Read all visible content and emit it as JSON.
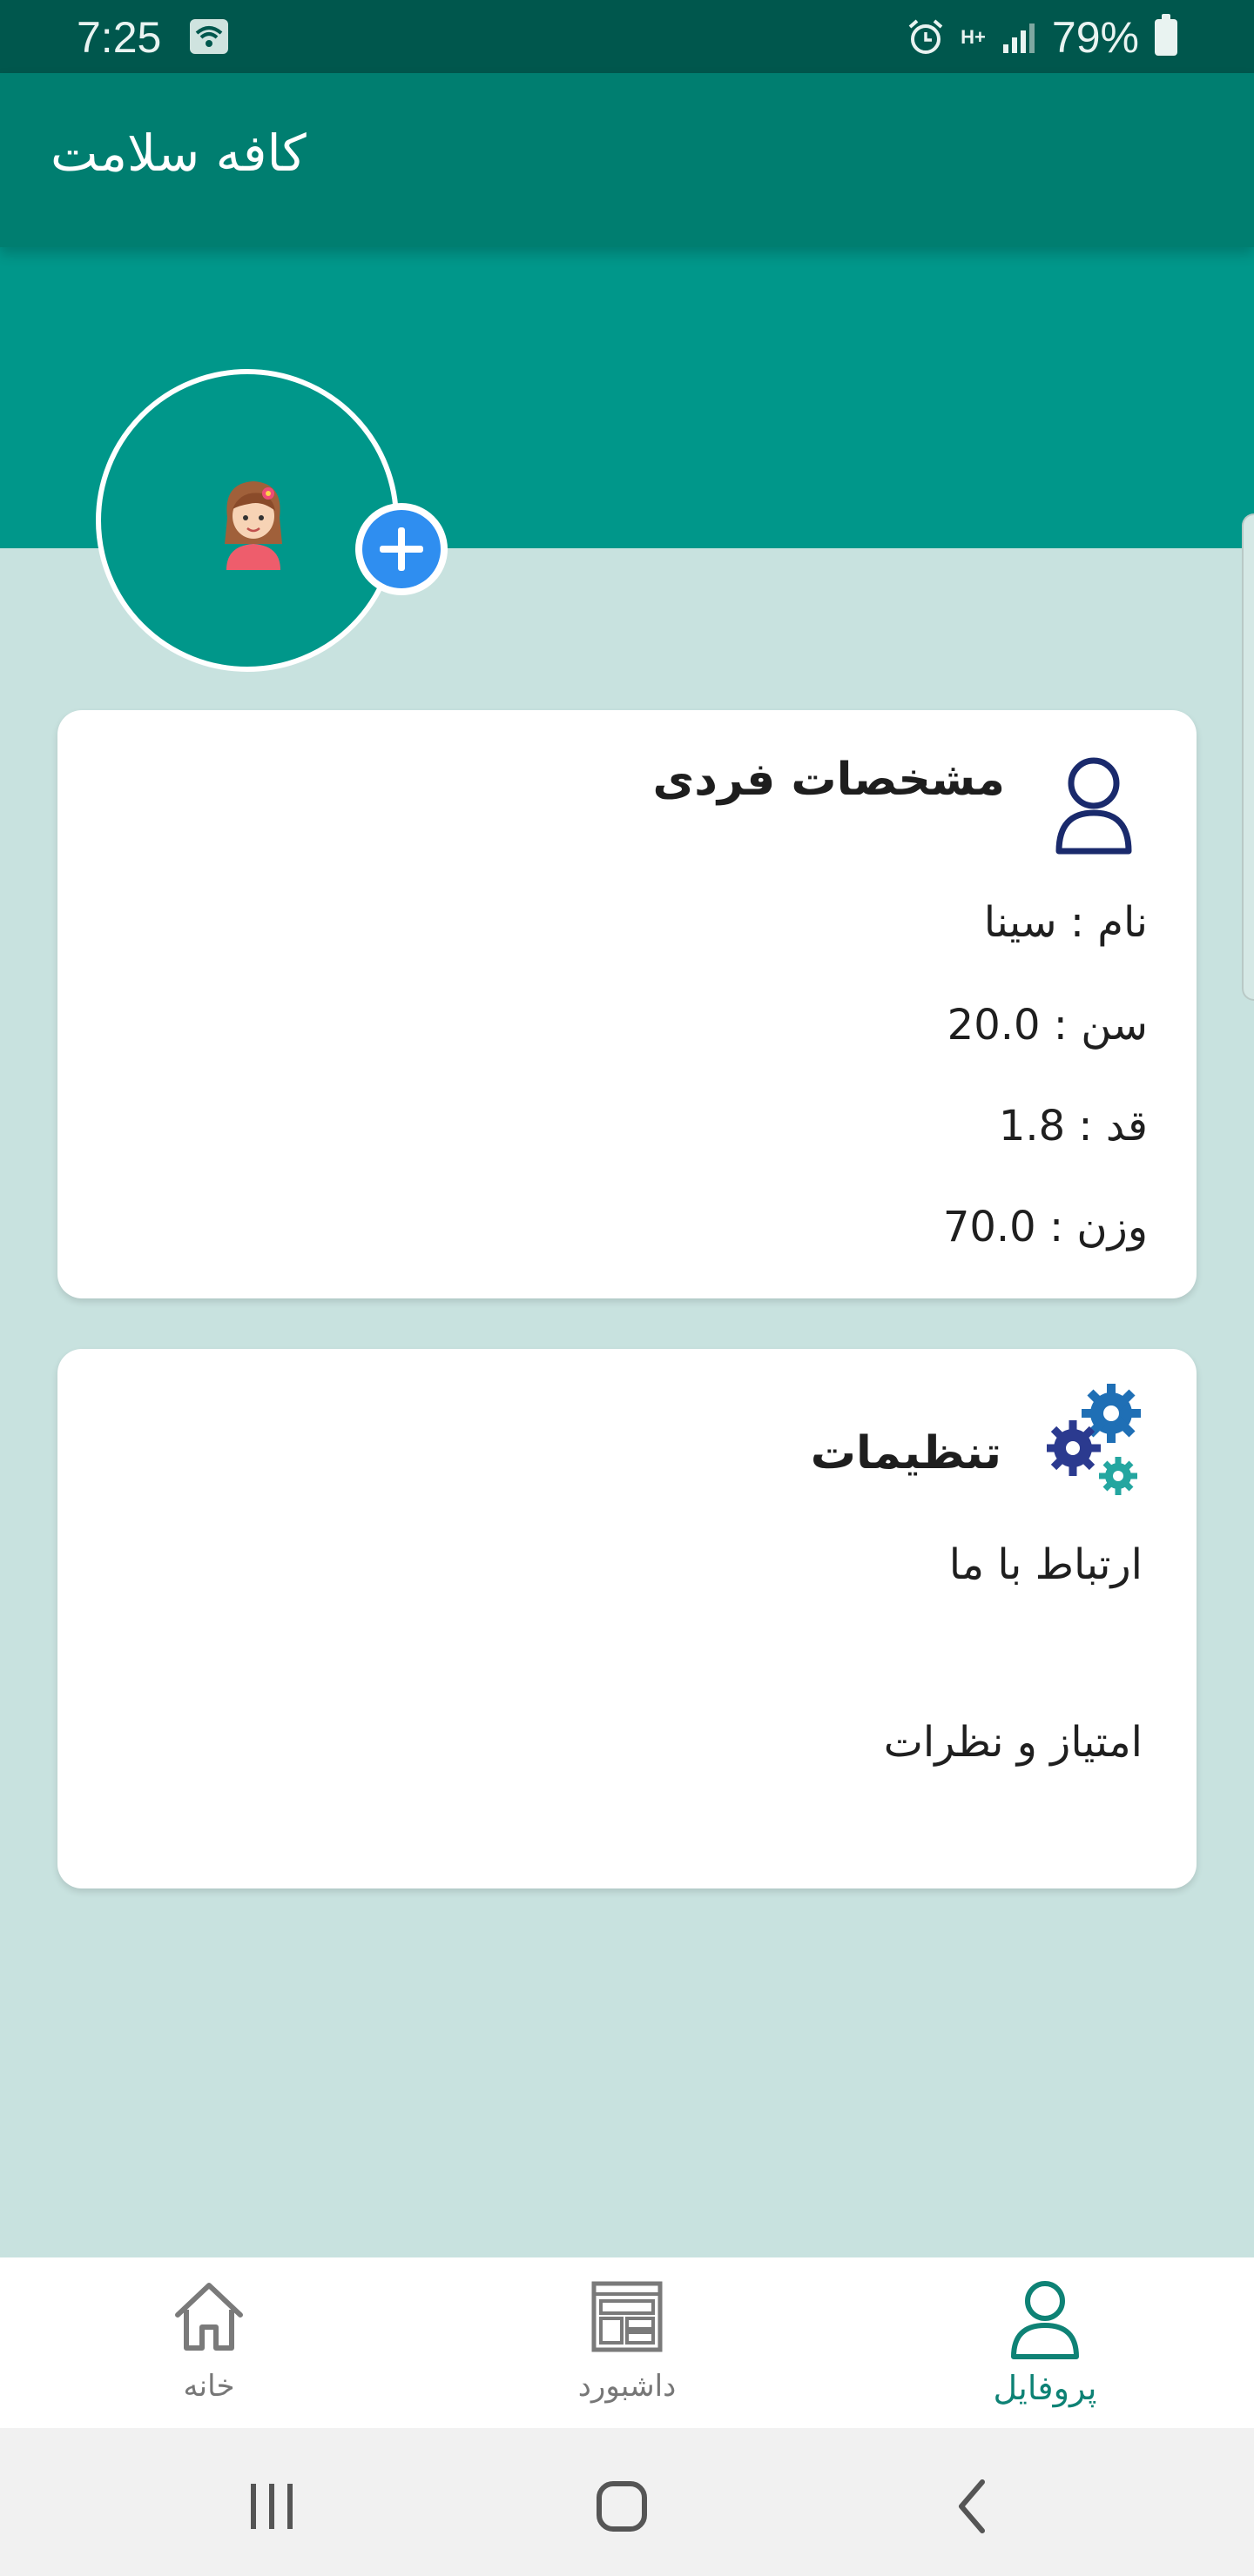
{
  "status_bar": {
    "time": "7:25",
    "battery": "79%",
    "net_label": "H+"
  },
  "app_bar": {
    "title": "کافه سلامت"
  },
  "colors": {
    "status_bar": "#00574d",
    "app_bar": "#007e70",
    "header_band": "#00978a",
    "background": "#c8e2df",
    "accent_blue": "#2f8ef0",
    "nav_active": "#0e8275",
    "icon_navy": "#1a2a6c"
  },
  "profile": {
    "avatar_icon": "girl-avatar-icon",
    "add_photo_icon": "plus-icon"
  },
  "personal_card": {
    "title": "مشخصات فردی",
    "icon": "person-icon",
    "name_row": "نام : سینا",
    "age_row": "سن : 20.0",
    "height_row": "قد : 1.8",
    "weight_row": "وزن : 70.0"
  },
  "settings_card": {
    "title": "تنظیمات",
    "icon": "gears-icon",
    "contact": "ارتباط با ما",
    "rate": "امتیاز و نظرات"
  },
  "bottom_nav": {
    "home": "خانه",
    "dashboard": "داشبورد",
    "profile": "پروفایل",
    "active": "profile"
  }
}
